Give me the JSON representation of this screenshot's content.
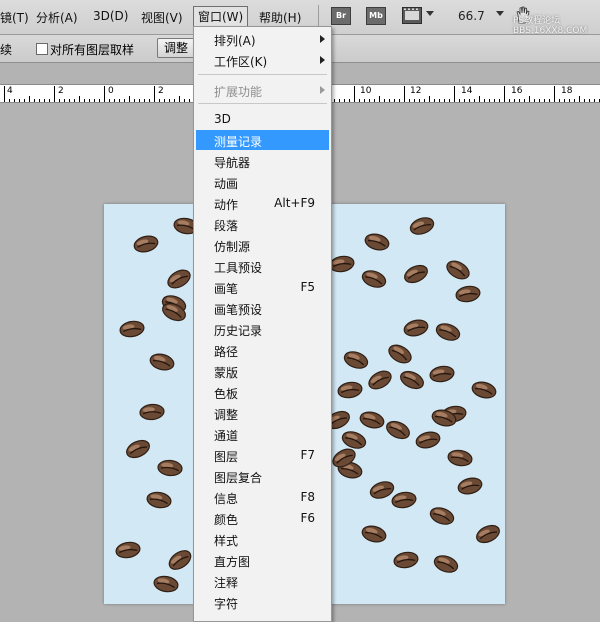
{
  "menubar": {
    "items": [
      {
        "label": "镜(T)"
      },
      {
        "label": "分析(A)"
      },
      {
        "label": "3D(D)"
      },
      {
        "label": "视图(V)"
      },
      {
        "label": "窗口(W)"
      },
      {
        "label": "帮助(H)"
      }
    ],
    "bridge_label": "Br",
    "mini_bridge_label": "Mb",
    "zoom": "66.7",
    "watermark": "PS教程论坛\nBBS.16XX8.COM"
  },
  "options_bar": {
    "left_fragment": "续",
    "sample_all_layers": "对所有图层取样",
    "adjust_button": "调整"
  },
  "ruler": {
    "labels": [
      "4",
      "2",
      "0",
      "2",
      "10",
      "12",
      "14",
      "16",
      "18"
    ]
  },
  "window_menu": {
    "items": [
      {
        "label": "排列(A)",
        "submenu": true
      },
      {
        "label": "工作区(K)",
        "submenu": true
      },
      {
        "label": "扩展功能",
        "submenu": true,
        "disabled": true
      },
      {
        "label": "3D"
      },
      {
        "label": "测量记录",
        "selected": true
      },
      {
        "label": "导航器"
      },
      {
        "label": "动画"
      },
      {
        "label": "动作",
        "shortcut": "Alt+F9"
      },
      {
        "label": "段落"
      },
      {
        "label": "仿制源"
      },
      {
        "label": "工具预设"
      },
      {
        "label": "画笔",
        "shortcut": "F5"
      },
      {
        "label": "画笔预设"
      },
      {
        "label": "历史记录"
      },
      {
        "label": "路径"
      },
      {
        "label": "蒙版"
      },
      {
        "label": "色板"
      },
      {
        "label": "调整"
      },
      {
        "label": "通道"
      },
      {
        "label": "图层",
        "shortcut": "F7"
      },
      {
        "label": "图层复合"
      },
      {
        "label": "信息",
        "shortcut": "F8"
      },
      {
        "label": "颜色",
        "shortcut": "F6"
      },
      {
        "label": "样式"
      },
      {
        "label": "直方图"
      },
      {
        "label": "注释"
      },
      {
        "label": "字符"
      }
    ]
  },
  "document": {
    "background_color": "#d2e9f5",
    "content": "scattered coffee beans"
  },
  "colors": {
    "menu_highlight": "#3399ff",
    "bean": "#6b4a35"
  }
}
